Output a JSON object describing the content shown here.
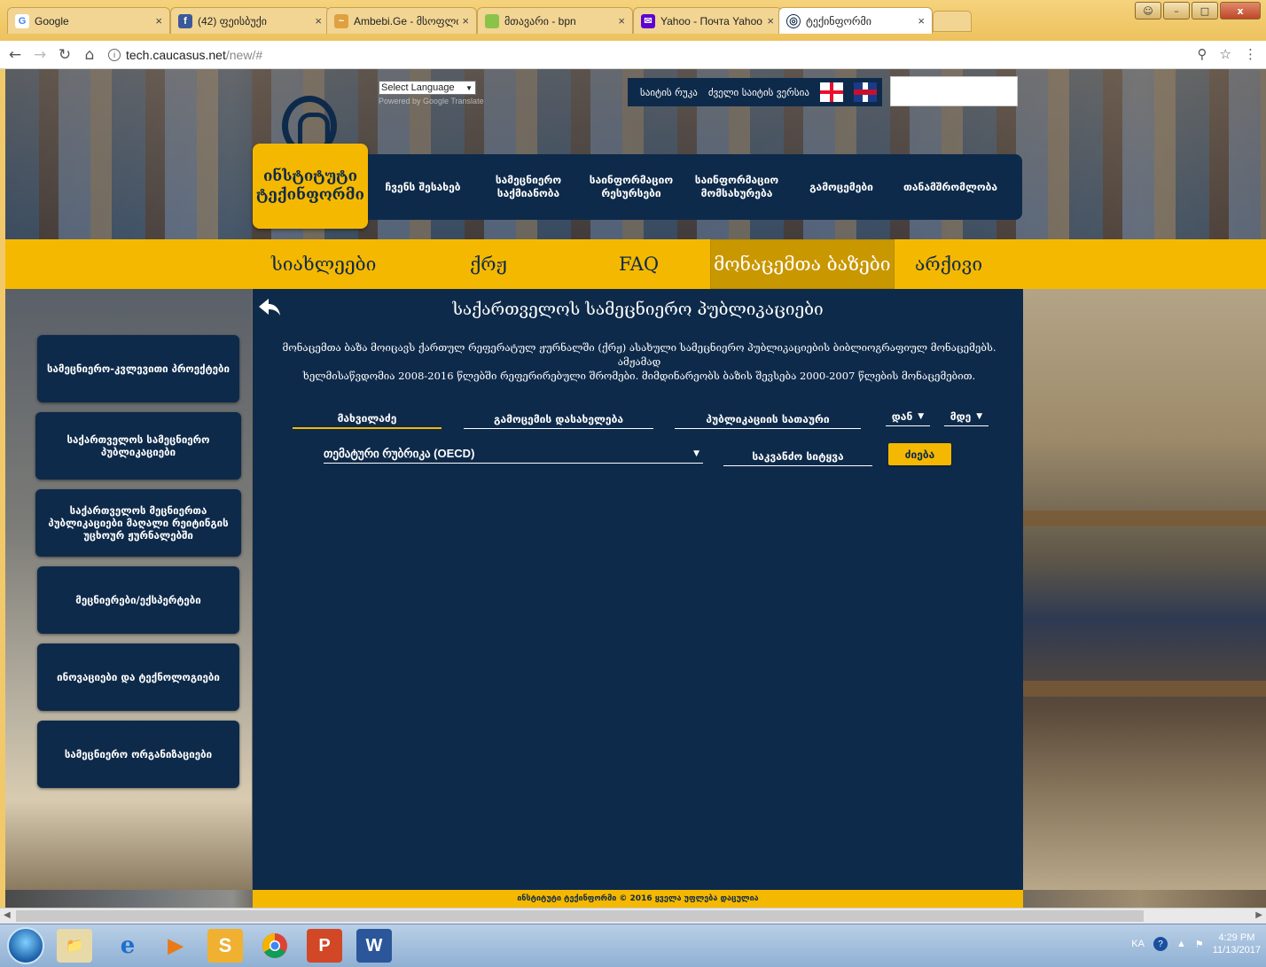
{
  "browser": {
    "tabs": [
      {
        "label": "Google",
        "favicon": "G",
        "favicon_color": "#4285f4",
        "active": false
      },
      {
        "label": "(42) ფეისბუქი",
        "favicon": "f",
        "favicon_color": "#3b5998",
        "active": false
      },
      {
        "label": "Ambebi.Ge - მსოფლიო",
        "favicon": "~",
        "favicon_color": "#e0a040",
        "active": false
      },
      {
        "label": "მთავარი - bpn",
        "favicon": "",
        "favicon_color": "#8bc34a",
        "active": false
      },
      {
        "label": "Yahoo - Почта Yahoo",
        "favicon": "✉",
        "favicon_color": "#5f01d1",
        "active": false
      },
      {
        "label": "ტექინფორმი",
        "favicon": "◎",
        "favicon_color": "#0e2a4a",
        "active": true
      }
    ],
    "close_glyph": "×",
    "url_host": "tech.caucasus.net",
    "url_path": "/new/#",
    "window_controls": {
      "close": "x"
    }
  },
  "site": {
    "logo_line1": "ინსტიტუტი",
    "logo_line2": "ტექინფორმი",
    "lang_select": "Select Language",
    "gt_credit": "Powered by Google Translate",
    "toplinks": {
      "sitemap": "საიტის რუკა",
      "old_site": "ძველი საიტის ვერსია"
    },
    "mainnav": [
      {
        "line1": "ჩვენს შესახებ",
        "line2": ""
      },
      {
        "line1": "სამეცნიერო",
        "line2": "საქმიანობა"
      },
      {
        "line1": "საინფორმაციო",
        "line2": "რესურსები"
      },
      {
        "line1": "საინფორმაციო",
        "line2": "მომსახურება"
      },
      {
        "line1": "გამოცემები",
        "line2": ""
      },
      {
        "line1": "თანამშრომლობა",
        "line2": ""
      }
    ],
    "subnav": [
      "სიახლეები",
      "ქრჟ",
      "FAQ",
      "მონაცემთა ბაზები",
      "არქივი"
    ],
    "sidebar": [
      "სამეცნიერო-კვლევითი პროექტები",
      "საქართველოს სამეცნიერო პუბლიკაციები",
      "საქართველოს მეცნიერთა პუბლიკაციები მაღალი რეიტინგის უცხოურ ჟურნალებში",
      "მეცნიერები/ექსპერტები",
      "ინოვაციები და ტექნოლოგიები",
      "სამეცნიერო ორგანიზაციები"
    ],
    "main": {
      "title": "საქართველოს სამეცნიერო პუბლიკაციები",
      "desc_line1": "მონაცემთა ბაზა მოიცავს ქართულ რეფერატულ ჟურნალში (ქრჟ) ასახული სამეცნიერო პუბლიკაციების ბიბლიოგრაფიულ მონაცემებს. ამჟამად",
      "desc_line2": "ხელმისაწვდომია 2008-2016 წლებში რეფერირებული შრომები. მიმდინარეობს ბაზის შევსება 2000-2007 წლების მონაცემებით.",
      "fields": {
        "author": "მახვილაძე",
        "publication_name": "გამოცემის დასახელება",
        "publication_title": "პუბლიკაციის სათაური",
        "from": "დან",
        "to": "მდე",
        "rubric": "თემატური რუბრიკა (OECD)",
        "keyword": "საკვანძო სიტყვა"
      },
      "search_button": "ძიება"
    },
    "footer": "ინსტიტუტი ტექინფორმი © 2016 ყველა უფლება დაცულია"
  },
  "taskbar": {
    "lang": "KA",
    "time": "4:29 PM",
    "date": "11/13/2017"
  }
}
